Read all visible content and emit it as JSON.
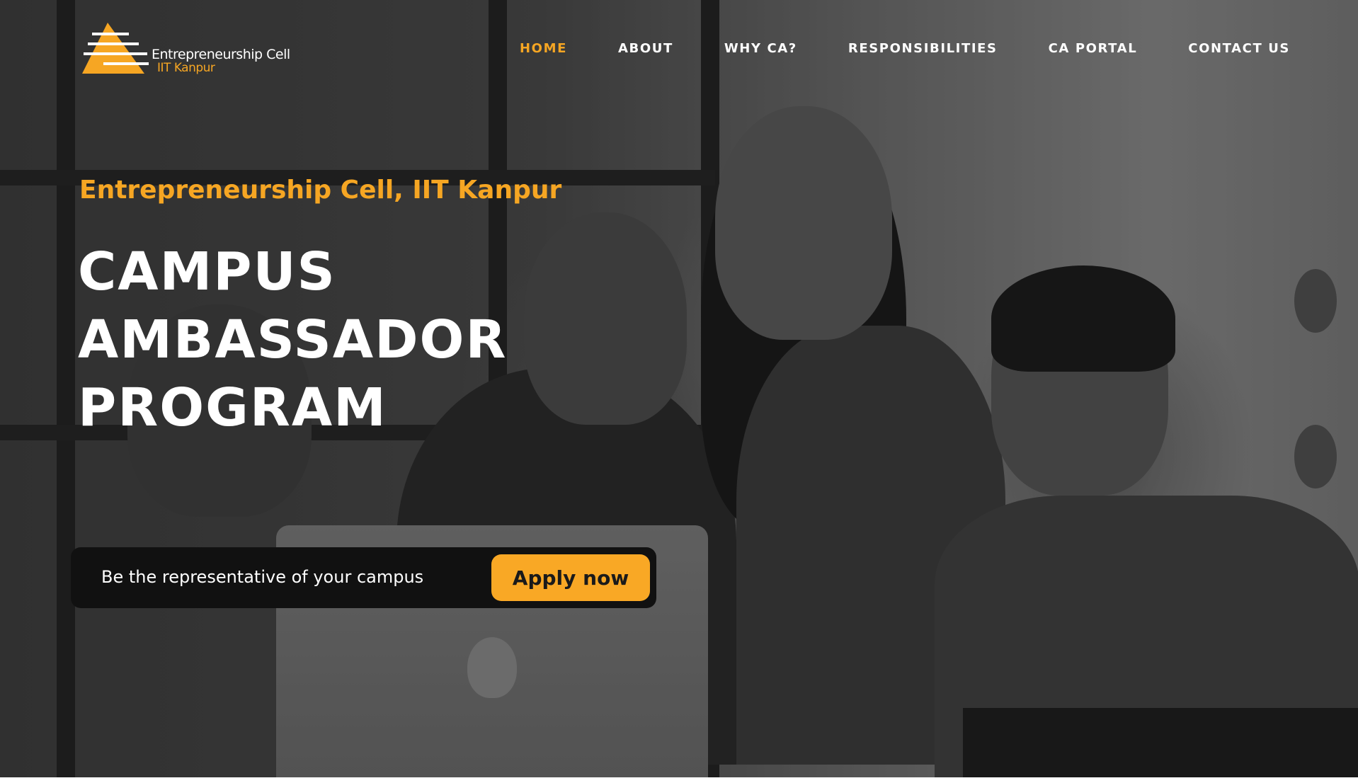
{
  "brand": {
    "logo_line_1": "Entrepreneurship Cell",
    "logo_line_2": "IIT Kanpur",
    "accent_color": "#f6a623"
  },
  "nav": {
    "items": [
      {
        "label": "HOME",
        "active": true
      },
      {
        "label": "ABOUT",
        "active": false
      },
      {
        "label": "WHY CA?",
        "active": false
      },
      {
        "label": "RESPONSIBILITIES",
        "active": false
      },
      {
        "label": "CA PORTAL",
        "active": false
      },
      {
        "label": "CONTACT US",
        "active": false
      }
    ]
  },
  "hero": {
    "tagline": "Entrepreneurship Cell, IIT Kanpur",
    "headline_lines": [
      "CAMPUS",
      "AMBASSADOR",
      "PROGRAM"
    ],
    "background_image": "black-and-white photo of four people smiling at a laptop"
  },
  "cta": {
    "text": "Be the representative of your campus",
    "button_label": "Apply now",
    "button_color": "#f9a825"
  }
}
